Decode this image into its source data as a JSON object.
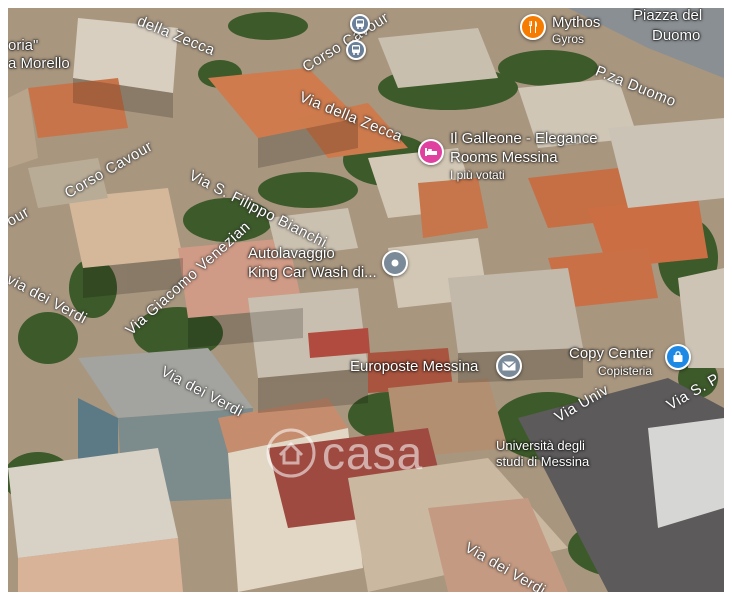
{
  "map": {
    "top_labels": {
      "left_top": "oria\"",
      "left_morello": "a Morello",
      "piazza_1": "Piazza del",
      "piazza_2": "Duomo"
    },
    "streets": {
      "della_zecca_top": "della Zecca",
      "corso_cavour_top": "Corso Cavour",
      "via_della_zecca": "Via della Zecca",
      "pza_duomo": "P.za Duomo",
      "corso_cavour": "Corso Cavour",
      "via_s_filippo": "Via S. Filippo Bianchi",
      "via_giacomo": "Via Giacomo Venezian",
      "via_dei_verdi_left": "via dei Verdi",
      "via_dei_verdi_mid": "Via dei Verdi",
      "via_dei_verdi_bottom": "Via dei Verdi",
      "via_univ": "Via Univ",
      "via_s": "Via S. P",
      "our_left": "our"
    },
    "pois": {
      "mythos": {
        "name": "Mythos",
        "sub": "Gyros",
        "icon": "restaurant-icon",
        "color": "#f57c00"
      },
      "galleone": {
        "name_1": "Il Galleone - Elegance",
        "name_2": "Rooms Messina",
        "sub": "I più votati",
        "icon": "bed-icon",
        "color": "#e040a0"
      },
      "autolavaggio": {
        "name_1": "Autolavaggio",
        "name_2": "King Car Wash di...",
        "icon": "place-icon",
        "color": "#7a8a99"
      },
      "europoste": {
        "name": "Europoste Messina",
        "icon": "mail-icon",
        "color": "#7a8a99"
      },
      "copy_center": {
        "name": "Copy Center",
        "sub": "Copisteria",
        "icon": "shopping-bag-icon",
        "color": "#1e88e5"
      },
      "universita": {
        "name_1": "Università degli",
        "name_2": "studi di Messina"
      },
      "bus": {
        "icon": "bus-stop-icon",
        "color": "#6a7f99"
      }
    },
    "watermark": "casa"
  }
}
